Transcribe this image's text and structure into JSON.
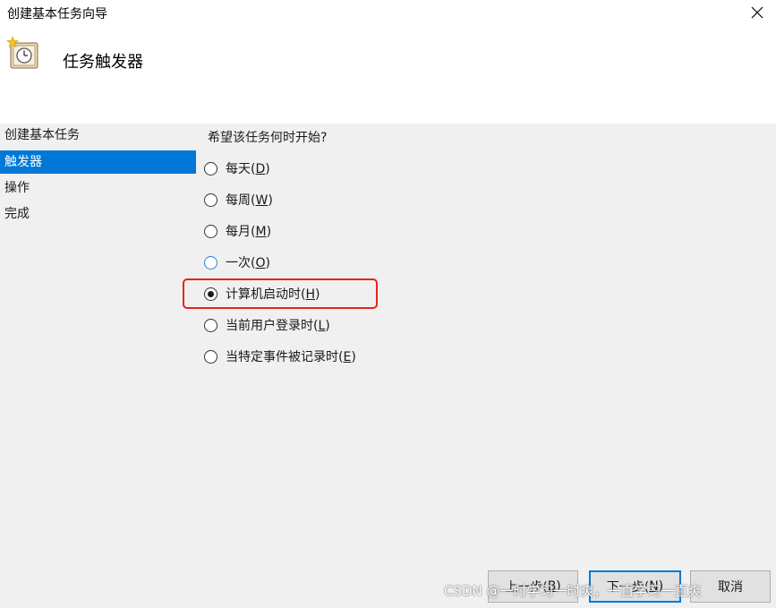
{
  "window": {
    "title": "创建基本任务向导",
    "close_icon": "close-icon"
  },
  "header": {
    "icon": "task-clock-icon",
    "title": "任务触发器"
  },
  "sidebar": {
    "items": [
      {
        "label": "创建基本任务",
        "active": false
      },
      {
        "label": "触发器",
        "active": true
      },
      {
        "label": "操作",
        "active": false
      },
      {
        "label": "完成",
        "active": false
      }
    ]
  },
  "main": {
    "question": "希望该任务何时开始?",
    "options": [
      {
        "text": "每天(",
        "key": "D",
        "close": ")",
        "selected": false
      },
      {
        "text": "每周(",
        "key": "W",
        "close": ")",
        "selected": false
      },
      {
        "text": "每月(",
        "key": "M",
        "close": ")",
        "selected": false
      },
      {
        "text": "一次(",
        "key": "O",
        "close": ")",
        "selected": false
      },
      {
        "text": "计算机启动时(",
        "key": "H",
        "close": ")",
        "selected": true
      },
      {
        "text": "当前用户登录时(",
        "key": "L",
        "close": ")",
        "selected": false
      },
      {
        "text": "当特定事件被记录时(",
        "key": "E",
        "close": ")",
        "selected": false
      }
    ],
    "highlight_color": "#e8231d"
  },
  "buttons": {
    "back": {
      "text": "上一步(",
      "key": "B",
      "close": ")"
    },
    "next": {
      "text": "下一步(",
      "key": "N",
      "close": ")"
    },
    "cancel": {
      "text": "取消"
    }
  },
  "watermark": "CSDN @一时学习一时爽，一直学习一直爽",
  "colors": {
    "accent": "#0078d7",
    "panel_bg": "#f0f0f0"
  }
}
